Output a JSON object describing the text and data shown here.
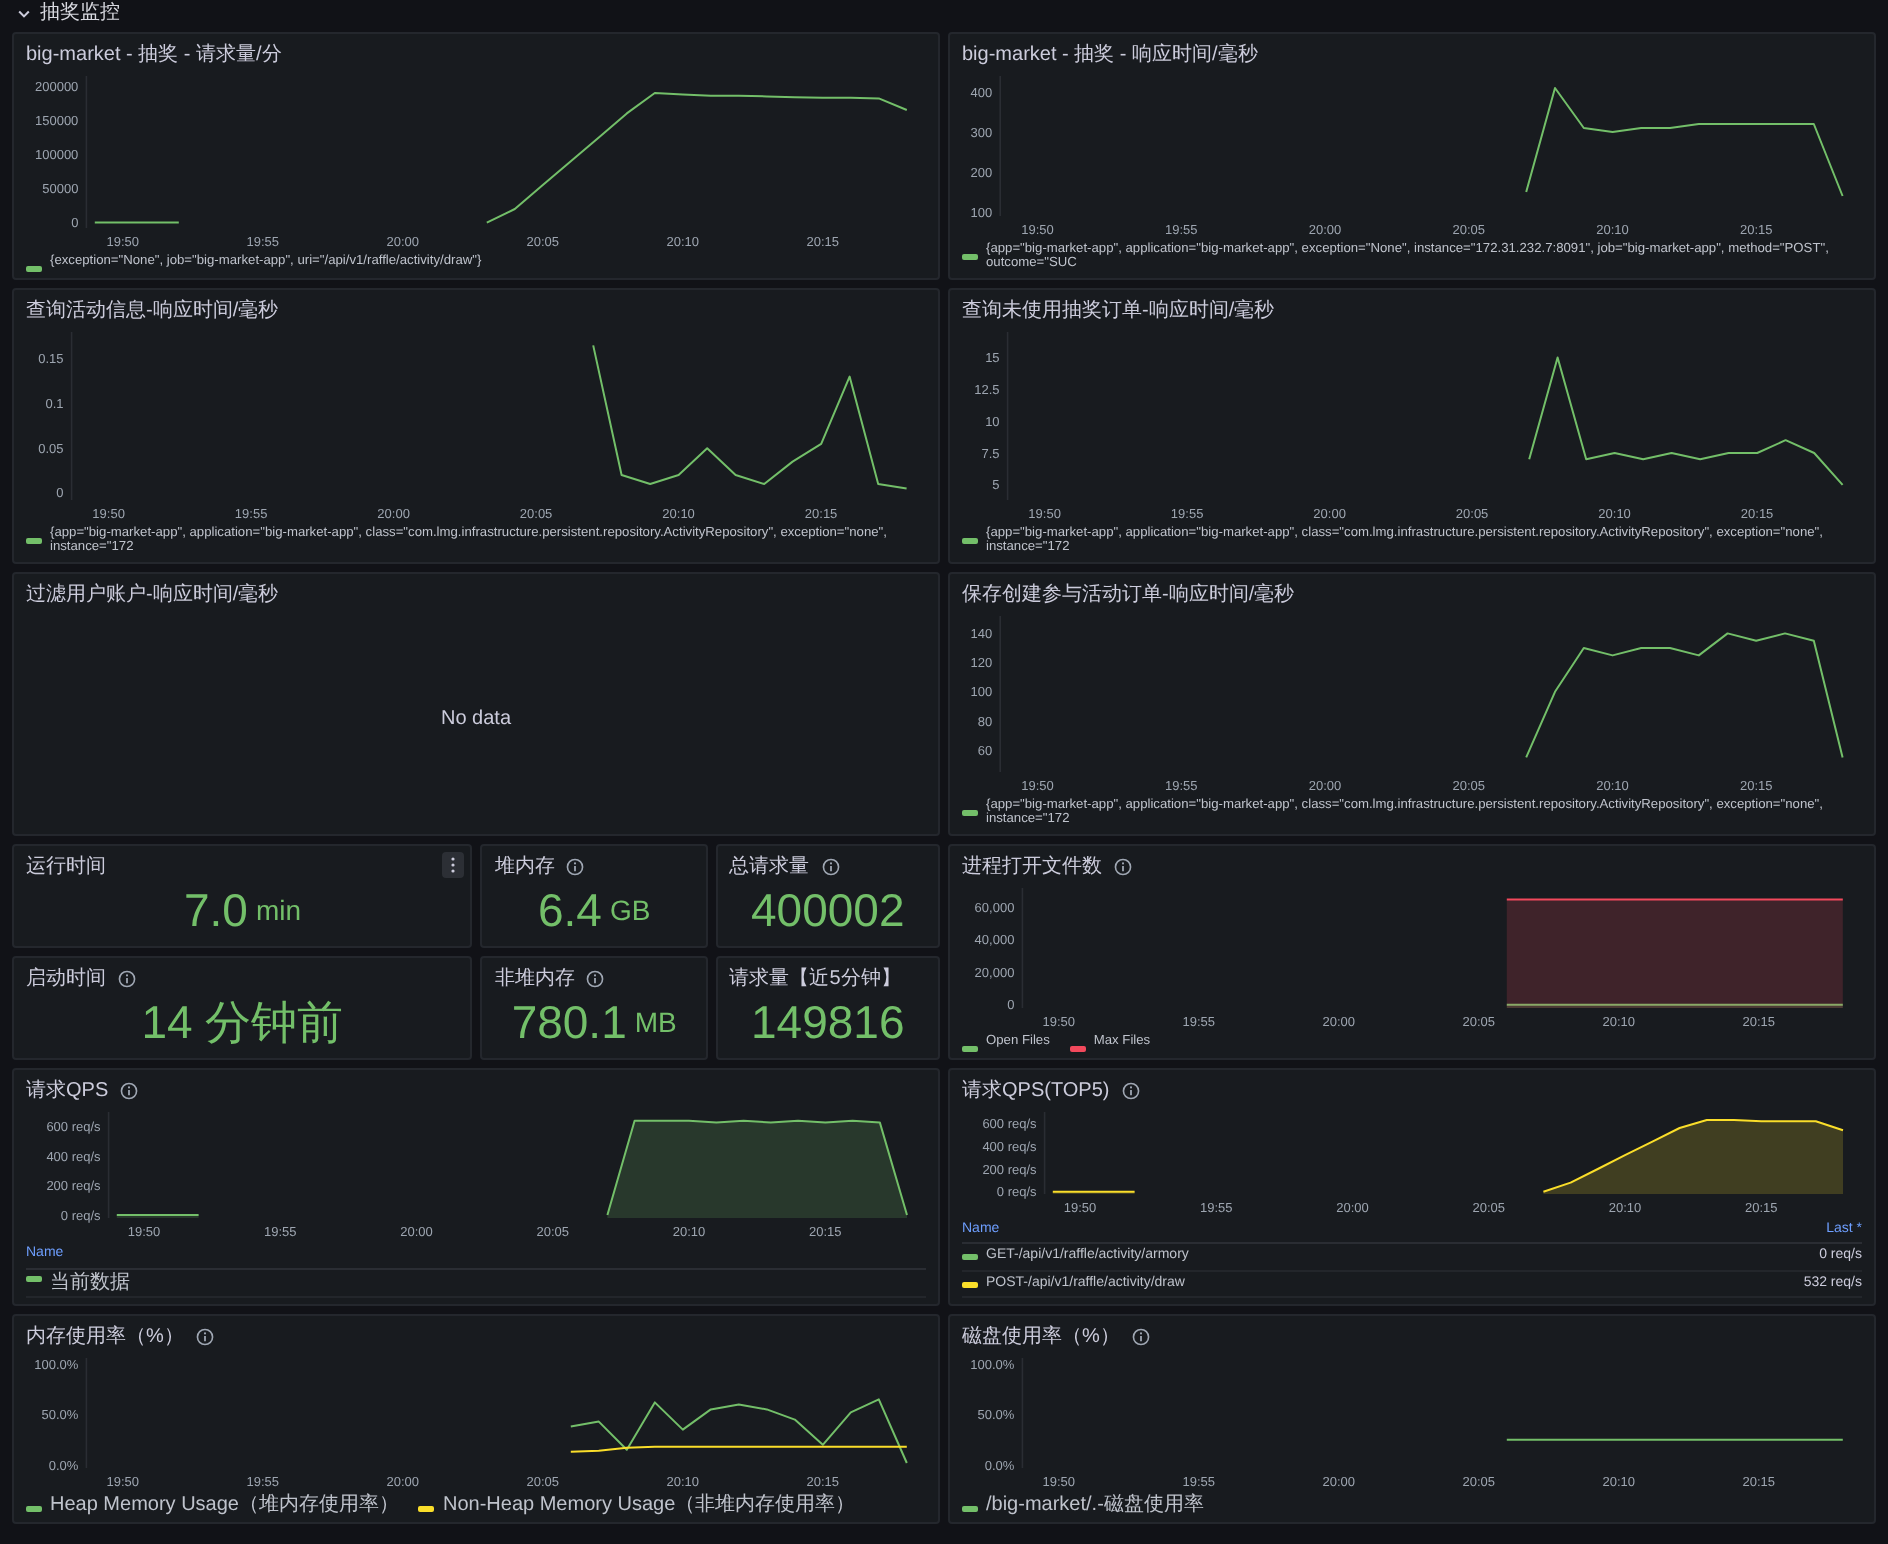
{
  "section": {
    "title": "抽奖监控",
    "expanded": true
  },
  "panels": [
    {
      "kind": "timeseries",
      "title": "big-market - 抽奖 - 请求量/分",
      "chart_data": {
        "type": "line",
        "categories": [
          null,
          "19:50",
          null,
          null,
          null,
          null,
          "19:55",
          null,
          null,
          null,
          null,
          "20:00",
          null,
          null,
          null,
          null,
          "20:05",
          null,
          null,
          null,
          null,
          "20:10",
          null,
          null,
          null,
          null,
          "20:15",
          null,
          null,
          null
        ],
        "ylim": [
          -8000,
          215000
        ],
        "yticks": [
          0,
          50000,
          100000,
          150000,
          200000
        ],
        "series": [
          {
            "name": "{exception=\"None\", job=\"big-market-app\", uri=\"/api/v1/raffle/activity/draw\"}",
            "color": "#73bf69",
            "values": [
              0,
              0,
              0,
              0,
              null,
              null,
              null,
              null,
              null,
              null,
              null,
              null,
              null,
              null,
              0,
              20000,
              55000,
              90000,
              125000,
              160000,
              190000,
              188000,
              186000,
              186000,
              185000,
              184000,
              183000,
              183000,
              182000,
              165000
            ]
          }
        ]
      }
    },
    {
      "kind": "timeseries",
      "title": "big-market - 抽奖 - 响应时间/毫秒",
      "chart_data": {
        "type": "line",
        "categories": [
          null,
          "19:50",
          null,
          null,
          null,
          null,
          "19:55",
          null,
          null,
          null,
          null,
          "20:00",
          null,
          null,
          null,
          null,
          "20:05",
          null,
          null,
          null,
          null,
          "20:10",
          null,
          null,
          null,
          null,
          "20:15",
          null,
          null,
          null
        ],
        "ylim": [
          90,
          440
        ],
        "yticks": [
          100,
          200,
          300,
          400
        ],
        "series": [
          {
            "name": "{app=\"big-market-app\", application=\"big-market-app\", exception=\"None\", instance=\"172.31.232.7:8091\", job=\"big-market-app\", method=\"POST\", outcome=\"SUC",
            "color": "#73bf69",
            "values": [
              null,
              null,
              null,
              null,
              null,
              null,
              null,
              null,
              null,
              null,
              null,
              null,
              null,
              null,
              null,
              null,
              null,
              null,
              150,
              410,
              310,
              300,
              310,
              310,
              320,
              320,
              320,
              320,
              320,
              140
            ]
          }
        ]
      }
    },
    {
      "kind": "timeseries",
      "title": "查询活动信息-响应时间/毫秒",
      "chart_data": {
        "type": "line",
        "categories": [
          null,
          "19:50",
          null,
          null,
          null,
          null,
          "19:55",
          null,
          null,
          null,
          null,
          "20:00",
          null,
          null,
          null,
          null,
          "20:05",
          null,
          null,
          null,
          null,
          "20:10",
          null,
          null,
          null,
          null,
          "20:15",
          null,
          null,
          null
        ],
        "ylim": [
          -0.008,
          0.18
        ],
        "yticks": [
          0,
          0.05,
          0.1,
          0.15
        ],
        "series": [
          {
            "name": "{app=\"big-market-app\", application=\"big-market-app\", class=\"com.lmg.infrastructure.persistent.repository.ActivityRepository\", exception=\"none\", instance=\"172",
            "color": "#73bf69",
            "values": [
              null,
              null,
              null,
              null,
              null,
              null,
              null,
              null,
              null,
              null,
              null,
              null,
              null,
              null,
              null,
              null,
              null,
              null,
              0.165,
              0.02,
              0.01,
              0.02,
              0.05,
              0.02,
              0.01,
              0.035,
              0.055,
              0.13,
              0.01,
              0.005
            ]
          }
        ]
      }
    },
    {
      "kind": "timeseries",
      "title": "查询未使用抽奖订单-响应时间/毫秒",
      "chart_data": {
        "type": "line",
        "categories": [
          null,
          "19:50",
          null,
          null,
          null,
          null,
          "19:55",
          null,
          null,
          null,
          null,
          "20:00",
          null,
          null,
          null,
          null,
          "20:05",
          null,
          null,
          null,
          null,
          "20:10",
          null,
          null,
          null,
          null,
          "20:15",
          null,
          null,
          null
        ],
        "ylim": [
          3.8,
          17
        ],
        "yticks": [
          5,
          7.5,
          10,
          12.5,
          15
        ],
        "series": [
          {
            "name": "{app=\"big-market-app\", application=\"big-market-app\", class=\"com.lmg.infrastructure.persistent.repository.ActivityRepository\", exception=\"none\", instance=\"172",
            "color": "#73bf69",
            "values": [
              null,
              null,
              null,
              null,
              null,
              null,
              null,
              null,
              null,
              null,
              null,
              null,
              null,
              null,
              null,
              null,
              null,
              null,
              7,
              15,
              7,
              7.5,
              7,
              7.5,
              7,
              7.5,
              7.5,
              8.5,
              7.5,
              5
            ]
          }
        ]
      }
    },
    {
      "kind": "nodata",
      "title": "过滤用户账户-响应时间/毫秒",
      "message": "No data"
    },
    {
      "kind": "timeseries",
      "title": "保存创建参与活动订单-响应时间/毫秒",
      "chart_data": {
        "type": "line",
        "categories": [
          null,
          "19:50",
          null,
          null,
          null,
          null,
          "19:55",
          null,
          null,
          null,
          null,
          "20:00",
          null,
          null,
          null,
          null,
          "20:05",
          null,
          null,
          null,
          null,
          "20:10",
          null,
          null,
          null,
          null,
          "20:15",
          null,
          null,
          null
        ],
        "ylim": [
          45,
          152
        ],
        "yticks": [
          60,
          80,
          100,
          120,
          140
        ],
        "series": [
          {
            "name": "{app=\"big-market-app\", application=\"big-market-app\", class=\"com.lmg.infrastructure.persistent.repository.ActivityRepository\", exception=\"none\", instance=\"172",
            "color": "#73bf69",
            "values": [
              null,
              null,
              null,
              null,
              null,
              null,
              null,
              null,
              null,
              null,
              null,
              null,
              null,
              null,
              null,
              null,
              null,
              null,
              55,
              100,
              130,
              125,
              130,
              130,
              125,
              140,
              135,
              140,
              135,
              55
            ]
          }
        ]
      }
    }
  ],
  "stats": [
    {
      "title": "运行时间",
      "menu": true,
      "value": "7.0",
      "unit": "min"
    },
    {
      "title": "堆内存",
      "info": true,
      "value": "6.4",
      "unit": "GB"
    },
    {
      "title": "总请求量",
      "info": true,
      "value": "400002"
    },
    {
      "title": "启动时间",
      "info": true,
      "value": "14 分钟前"
    },
    {
      "title": "非堆内存",
      "info": true,
      "value": "780.1",
      "unit": "MB"
    },
    {
      "title": "请求量【近5分钟】",
      "value": "149816"
    }
  ],
  "bottom_panels": [
    {
      "kind": "timeseries",
      "title": "进程打开文件数",
      "info": true,
      "chart_data": {
        "type": "area",
        "categories": [
          null,
          "19:50",
          null,
          null,
          null,
          null,
          "19:55",
          null,
          null,
          null,
          null,
          "20:00",
          null,
          null,
          null,
          null,
          "20:05",
          null,
          null,
          null,
          null,
          "20:10",
          null,
          null,
          null,
          null,
          "20:15",
          null,
          null,
          null
        ],
        "ylim": [
          -2000,
          72000
        ],
        "yticks": [
          {
            "value": 0,
            "label": "0"
          },
          {
            "value": 20000,
            "label": "20,000"
          },
          {
            "value": 40000,
            "label": "40,000"
          },
          {
            "value": 60000,
            "label": "60,000"
          }
        ],
        "series": [
          {
            "name": "Open Files",
            "color": "#73bf69",
            "values": [
              null,
              null,
              null,
              null,
              null,
              null,
              null,
              null,
              null,
              null,
              null,
              null,
              null,
              null,
              null,
              null,
              null,
              0,
              0,
              0,
              0,
              0,
              0,
              0,
              0,
              0,
              0,
              0,
              0,
              0
            ]
          },
          {
            "name": "Max Files",
            "color": "#f2495c",
            "values": [
              null,
              null,
              null,
              null,
              null,
              null,
              null,
              null,
              null,
              null,
              null,
              null,
              null,
              null,
              null,
              null,
              null,
              65000,
              65000,
              65000,
              65000,
              65000,
              65000,
              65000,
              65000,
              65000,
              65000,
              65000,
              65000,
              65000
            ]
          }
        ]
      }
    },
    {
      "kind": "timeseries",
      "title": "请求QPS",
      "info": true,
      "legend_table": {
        "columns": [
          "Name"
        ]
      },
      "chart_data": {
        "type": "area",
        "categories": [
          null,
          "19:50",
          null,
          null,
          null,
          null,
          "19:55",
          null,
          null,
          null,
          null,
          "20:00",
          null,
          null,
          null,
          null,
          "20:05",
          null,
          null,
          null,
          null,
          "20:10",
          null,
          null,
          null,
          null,
          "20:15",
          null,
          null,
          null
        ],
        "ylim": [
          -20,
          700
        ],
        "yticks": [
          {
            "value": 0,
            "label": "0 req/s"
          },
          {
            "value": 200,
            "label": "200 req/s"
          },
          {
            "value": 400,
            "label": "400 req/s"
          },
          {
            "value": 600,
            "label": "600 req/s"
          }
        ],
        "series": [
          {
            "name": "当前数据",
            "color": "#73bf69",
            "values": [
              0,
              0,
              0,
              0,
              null,
              null,
              null,
              null,
              null,
              null,
              null,
              null,
              null,
              null,
              null,
              null,
              null,
              null,
              0,
              640,
              640,
              640,
              630,
              640,
              630,
              640,
              630,
              640,
              630,
              0
            ]
          }
        ]
      }
    },
    {
      "kind": "timeseries",
      "title": "请求QPS(TOP5)",
      "info": true,
      "legend_table": {
        "columns": [
          "Name",
          "Last *"
        ],
        "last": [
          "0 req/s",
          "532 req/s"
        ]
      },
      "chart_data": {
        "type": "area",
        "categories": [
          null,
          "19:50",
          null,
          null,
          null,
          null,
          "19:55",
          null,
          null,
          null,
          null,
          "20:00",
          null,
          null,
          null,
          null,
          "20:05",
          null,
          null,
          null,
          null,
          "20:10",
          null,
          null,
          null,
          null,
          "20:15",
          null,
          null,
          null
        ],
        "ylim": [
          -20,
          700
        ],
        "yticks": [
          {
            "value": 0,
            "label": "0 req/s"
          },
          {
            "value": 200,
            "label": "200 req/s"
          },
          {
            "value": 400,
            "label": "400 req/s"
          },
          {
            "value": 600,
            "label": "600 req/s"
          }
        ],
        "series": [
          {
            "name": "GET-/api/v1/raffle/activity/armory",
            "color": "#73bf69",
            "values": [
              null,
              null,
              null,
              null,
              null,
              null,
              null,
              null,
              null,
              null,
              null,
              null,
              null,
              null,
              null,
              null,
              null,
              null,
              null,
              null,
              null,
              null,
              null,
              null,
              null,
              null,
              null,
              null,
              null,
              null
            ]
          },
          {
            "name": "POST-/api/v1/raffle/activity/draw",
            "color": "#fade2a",
            "values": [
              0,
              0,
              0,
              0,
              null,
              null,
              null,
              null,
              null,
              null,
              null,
              null,
              null,
              null,
              null,
              null,
              null,
              null,
              0,
              80,
              200,
              320,
              440,
              560,
              630,
              630,
              620,
              620,
              620,
              540
            ]
          }
        ]
      }
    },
    {
      "kind": "timeseries",
      "title": "内存使用率（%）",
      "info": true,
      "chart_data": {
        "type": "line",
        "categories": [
          null,
          "19:50",
          null,
          null,
          null,
          null,
          "19:55",
          null,
          null,
          null,
          null,
          "20:00",
          null,
          null,
          null,
          null,
          "20:05",
          null,
          null,
          null,
          null,
          "20:10",
          null,
          null,
          null,
          null,
          "20:15",
          null,
          null,
          null
        ],
        "ylim": [
          -3,
          106
        ],
        "yticks": [
          {
            "value": 0,
            "label": "0.0%"
          },
          {
            "value": 50,
            "label": "50.0%"
          },
          {
            "value": 100,
            "label": "100.0%"
          }
        ],
        "series": [
          {
            "name": "Heap Memory Usage（堆内存使用率）",
            "color": "#73bf69",
            "values": [
              null,
              null,
              null,
              null,
              null,
              null,
              null,
              null,
              null,
              null,
              null,
              null,
              null,
              null,
              null,
              null,
              null,
              38,
              43,
              15,
              62,
              35,
              55,
              60,
              55,
              45,
              20,
              52,
              65,
              2
            ]
          },
          {
            "name": "Non-Heap Memory Usage（非堆内存使用率）",
            "color": "#fade2a",
            "values": [
              null,
              null,
              null,
              null,
              null,
              null,
              null,
              null,
              null,
              null,
              null,
              null,
              null,
              null,
              null,
              null,
              null,
              13,
              14,
              17,
              18,
              18,
              18,
              18,
              18,
              18,
              18,
              18,
              18,
              18
            ]
          }
        ]
      }
    },
    {
      "kind": "timeseries",
      "title": "磁盘使用率（%）",
      "info": true,
      "chart_data": {
        "type": "line",
        "categories": [
          null,
          "19:50",
          null,
          null,
          null,
          null,
          "19:55",
          null,
          null,
          null,
          null,
          "20:00",
          null,
          null,
          null,
          null,
          "20:05",
          null,
          null,
          null,
          null,
          "20:10",
          null,
          null,
          null,
          null,
          "20:15",
          null,
          null,
          null
        ],
        "ylim": [
          -3,
          106
        ],
        "yticks": [
          {
            "value": 0,
            "label": "0.0%"
          },
          {
            "value": 50,
            "label": "50.0%"
          },
          {
            "value": 100,
            "label": "100.0%"
          }
        ],
        "series": [
          {
            "name": "/big-market/.-磁盘使用率",
            "color": "#73bf69",
            "values": [
              null,
              null,
              null,
              null,
              null,
              null,
              null,
              null,
              null,
              null,
              null,
              null,
              null,
              null,
              null,
              null,
              null,
              25,
              25,
              25,
              25,
              25,
              25,
              25,
              25,
              25,
              25,
              25,
              25,
              25
            ]
          }
        ]
      }
    }
  ]
}
